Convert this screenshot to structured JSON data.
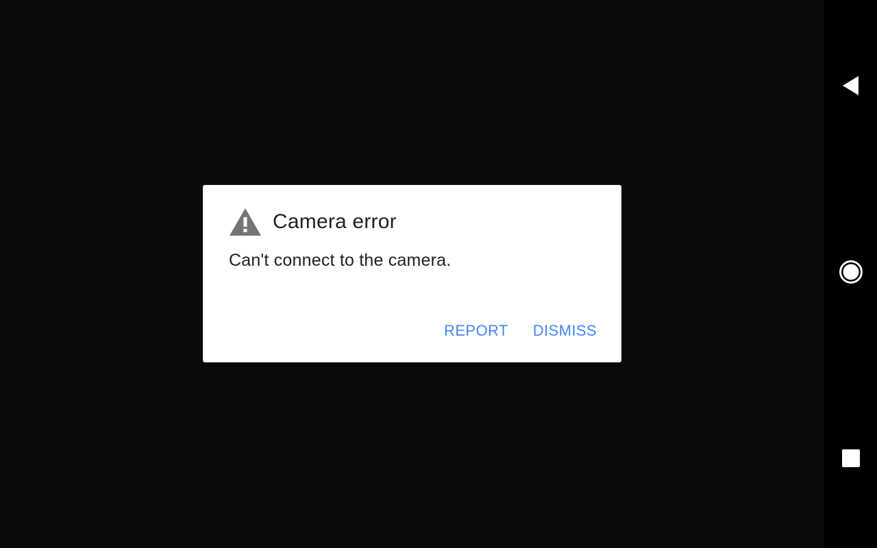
{
  "dialog": {
    "icon": "warning-icon",
    "title": "Camera error",
    "message": "Can't connect to the camera.",
    "actions": {
      "report_label": "REPORT",
      "dismiss_label": "DISMISS"
    }
  },
  "nav_bar": {
    "back_icon": "back-triangle-icon",
    "home_icon": "home-circle-icon",
    "recents_icon": "recents-square-icon"
  },
  "colors": {
    "background": "#0b0b0b",
    "nav_bar": "#000000",
    "dialog_bg": "#ffffff",
    "title_text": "#212121",
    "accent": "#4285f4",
    "icon_gray": "#757575"
  }
}
